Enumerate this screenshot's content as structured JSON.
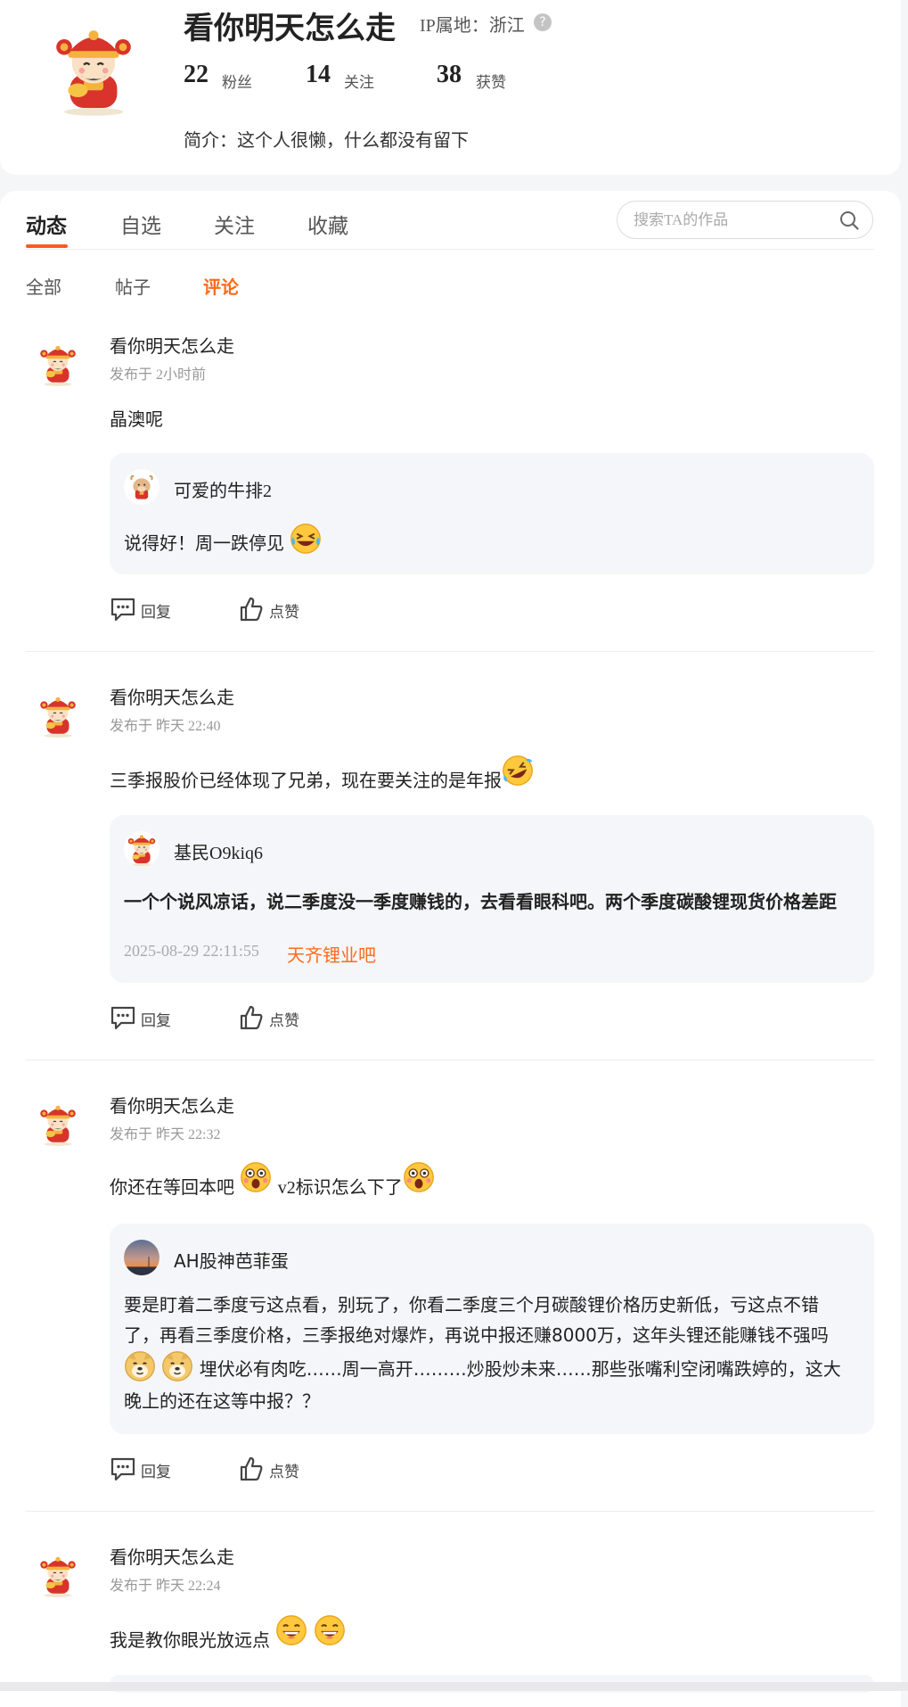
{
  "profile": {
    "name": "看你明天怎么走",
    "ip_label": "IP属地：浙江",
    "stats": [
      {
        "num": "22",
        "label": "粉丝"
      },
      {
        "num": "14",
        "label": "关注"
      },
      {
        "num": "38",
        "label": "获赞"
      }
    ],
    "bio": "简介：这个人很懒，什么都没有留下"
  },
  "tabs": [
    "动态",
    "自选",
    "关注",
    "收藏"
  ],
  "active_tab": "动态",
  "search": {
    "placeholder": "搜索TA的作品"
  },
  "subtabs": [
    "全部",
    "帖子",
    "评论"
  ],
  "active_subtab": "评论",
  "actions": {
    "reply": "回复",
    "like": "点赞"
  },
  "posts": [
    {
      "author": "看你明天怎么走",
      "time": "发布于 2小时前",
      "content": "晶澳呢",
      "quote": {
        "author": "可爱的牛排2",
        "text": "说得好！周一跌停见"
      }
    },
    {
      "author": "看你明天怎么走",
      "time": "发布于 昨天 22:40",
      "content": "三季报股价已经体现了兄弟，现在要关注的是年报",
      "quote": {
        "author": "基民O9kiq6",
        "text": "一个个说风凉话，说二季度没一季度赚钱的，去看看眼科吧。两个季度碳酸锂现货价格差距",
        "date": "2025-08-29 22:11:55",
        "link": "天齐锂业吧"
      }
    },
    {
      "author": "看你明天怎么走",
      "time": "发布于 昨天 22:32",
      "content_a": "你还在等回本吧",
      "content_b": "v2标识怎么下了",
      "quote": {
        "author": "AH股神芭菲蛋",
        "line1": "要是盯着二季度亏这点看，别玩了，你看二季度三个月碳酸锂价格历史新低，亏这点不错",
        "line2": "了，再看三季度价格，三季报绝对爆炸，再说中报还赚8000万，这年头锂还能赚钱不强吗",
        "line3": "埋伏必有肉吃……周一高开………炒股炒未来……那些张嘴利空闭嘴跌婷的，这大",
        "line4": "晚上的还在这等中报？？"
      }
    },
    {
      "author": "看你明天怎么走",
      "time": "发布于 昨天 22:24",
      "content": "我是教你眼光放远点"
    }
  ],
  "colors": {
    "accent": "#ff6a1a",
    "quote_bg": "#f5f6f9"
  }
}
